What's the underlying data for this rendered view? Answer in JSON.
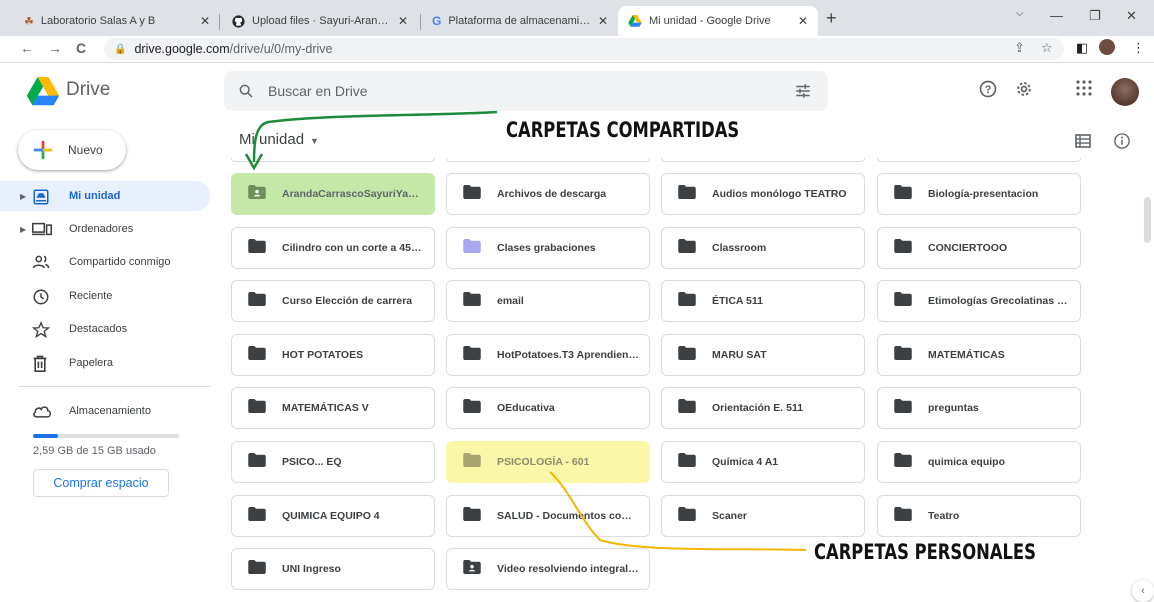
{
  "browser": {
    "tabs": [
      {
        "title": "Laboratorio Salas A y B",
        "icon": "lab-favicon-icon",
        "active": false
      },
      {
        "title": "Upload files · Sayuri-ArandaC30/",
        "icon": "github-icon",
        "active": false
      },
      {
        "title": "Plataforma de almacenamiento p",
        "icon": "google-icon",
        "active": false
      },
      {
        "title": "Mi unidad - Google Drive",
        "icon": "drive-icon",
        "active": true
      }
    ],
    "url_host": "drive.google.com",
    "url_path": "/drive/u/0/my-drive"
  },
  "header": {
    "app_name": "Drive",
    "search_placeholder": "Buscar en Drive"
  },
  "sidebar": {
    "new_label": "Nuevo",
    "items": [
      {
        "label": "Mi unidad",
        "icon": "my-drive-icon",
        "active": true,
        "expandable": true
      },
      {
        "label": "Ordenadores",
        "icon": "computer-icon",
        "active": false,
        "expandable": true
      },
      {
        "label": "Compartido conmigo",
        "icon": "shared-people-icon",
        "active": false,
        "expandable": false
      },
      {
        "label": "Reciente",
        "icon": "clock-icon",
        "active": false,
        "expandable": false
      },
      {
        "label": "Destacados",
        "icon": "star-icon",
        "active": false,
        "expandable": false
      },
      {
        "label": "Papelera",
        "icon": "trash-icon",
        "active": false,
        "expandable": false
      }
    ],
    "storage_label": "Almacenamiento",
    "storage_used_text": "2,59 GB de 15 GB usado",
    "storage_fraction": 0.17,
    "buy_label": "Comprar espacio"
  },
  "main": {
    "title": "Mi unidad",
    "folders": [
      {
        "name": "ArandaCarrascoSayuriYamil...",
        "shared": true,
        "highlight": "green"
      },
      {
        "name": "Archivos de descarga",
        "shared": false
      },
      {
        "name": "Audios monólogo TEATRO",
        "shared": false
      },
      {
        "name": "Biología-presentacion",
        "shared": false
      },
      {
        "name": "Cilindro con un corte a 45° -...",
        "shared": false
      },
      {
        "name": "Clases grabaciones",
        "shared": false,
        "color": "#a8a8f0"
      },
      {
        "name": "Classroom",
        "shared": false
      },
      {
        "name": "CONCIERTOOO",
        "shared": false
      },
      {
        "name": "Curso Elección de carrera",
        "shared": false
      },
      {
        "name": "email",
        "shared": false
      },
      {
        "name": "ÉTICA 511",
        "shared": false
      },
      {
        "name": "Etimologías Grecolatinas 511",
        "shared": false
      },
      {
        "name": "HOT POTATOES",
        "shared": false
      },
      {
        "name": "HotPotatoes.T3 Aprendiend...",
        "shared": false
      },
      {
        "name": "MARU SAT",
        "shared": false
      },
      {
        "name": "MATEMÁTICAS",
        "shared": false
      },
      {
        "name": "MATEMÁTICAS V",
        "shared": false
      },
      {
        "name": "OEducativa",
        "shared": false
      },
      {
        "name": "Orientación E. 511",
        "shared": false
      },
      {
        "name": "preguntas",
        "shared": false
      },
      {
        "name": "PSICO... EQ",
        "shared": false
      },
      {
        "name": "PSICOLOGÍA - 601",
        "shared": false,
        "highlight": "yellow"
      },
      {
        "name": "Química 4 A1",
        "shared": false
      },
      {
        "name": "quimica equipo",
        "shared": false
      },
      {
        "name": "QUIMICA EQUIPO 4",
        "shared": false
      },
      {
        "name": "SALUD - Documentos comp...",
        "shared": false
      },
      {
        "name": "Scaner",
        "shared": false
      },
      {
        "name": "Teatro",
        "shared": false
      },
      {
        "name": "UNI Ingreso",
        "shared": false
      },
      {
        "name": "Video resolviendo integral - ...",
        "shared": true
      }
    ]
  },
  "annotations": {
    "shared_label": "CARPETAS COMPARTIDAS",
    "personal_label": "CARPETAS PERSONALES",
    "shared_color": "#1e8a3c",
    "personal_color": "#f2b705"
  }
}
